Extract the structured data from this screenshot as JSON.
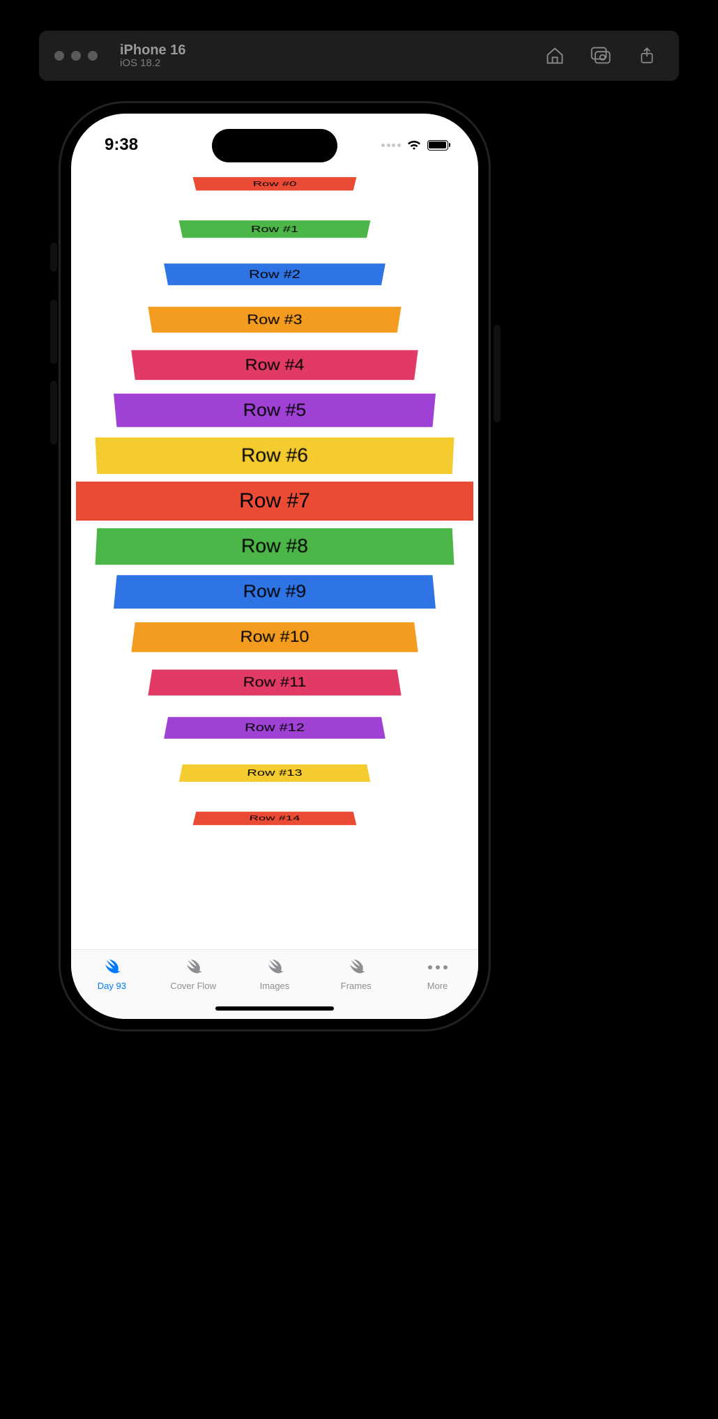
{
  "simulator": {
    "device_title": "iPhone 16",
    "os_version": "iOS 18.2"
  },
  "status": {
    "time": "9:38"
  },
  "content": {
    "row_label_prefix": "Row #",
    "center_index": 7,
    "max_row_width": 570,
    "rows": [
      {
        "index": 0,
        "color": "#e94b35"
      },
      {
        "index": 1,
        "color": "#4cb648"
      },
      {
        "index": 2,
        "color": "#2f74e5"
      },
      {
        "index": 3,
        "color": "#f39c1f"
      },
      {
        "index": 4,
        "color": "#e03a65"
      },
      {
        "index": 5,
        "color": "#a041d6"
      },
      {
        "index": 6,
        "color": "#f4cc2f"
      },
      {
        "index": 7,
        "color": "#e94b35"
      },
      {
        "index": 8,
        "color": "#4cb648"
      },
      {
        "index": 9,
        "color": "#2f74e5"
      },
      {
        "index": 10,
        "color": "#f39c1f"
      },
      {
        "index": 11,
        "color": "#e03a65"
      },
      {
        "index": 12,
        "color": "#a041d6"
      },
      {
        "index": 13,
        "color": "#f4cc2f"
      },
      {
        "index": 14,
        "color": "#e94b35"
      }
    ]
  },
  "tabs": {
    "items": [
      {
        "label": "Day 93",
        "icon": "swift-icon",
        "active": true
      },
      {
        "label": "Cover Flow",
        "icon": "swift-icon",
        "active": false
      },
      {
        "label": "Images",
        "icon": "swift-icon",
        "active": false
      },
      {
        "label": "Frames",
        "icon": "swift-icon",
        "active": false
      },
      {
        "label": "More",
        "icon": "more-icon",
        "active": false
      }
    ]
  }
}
